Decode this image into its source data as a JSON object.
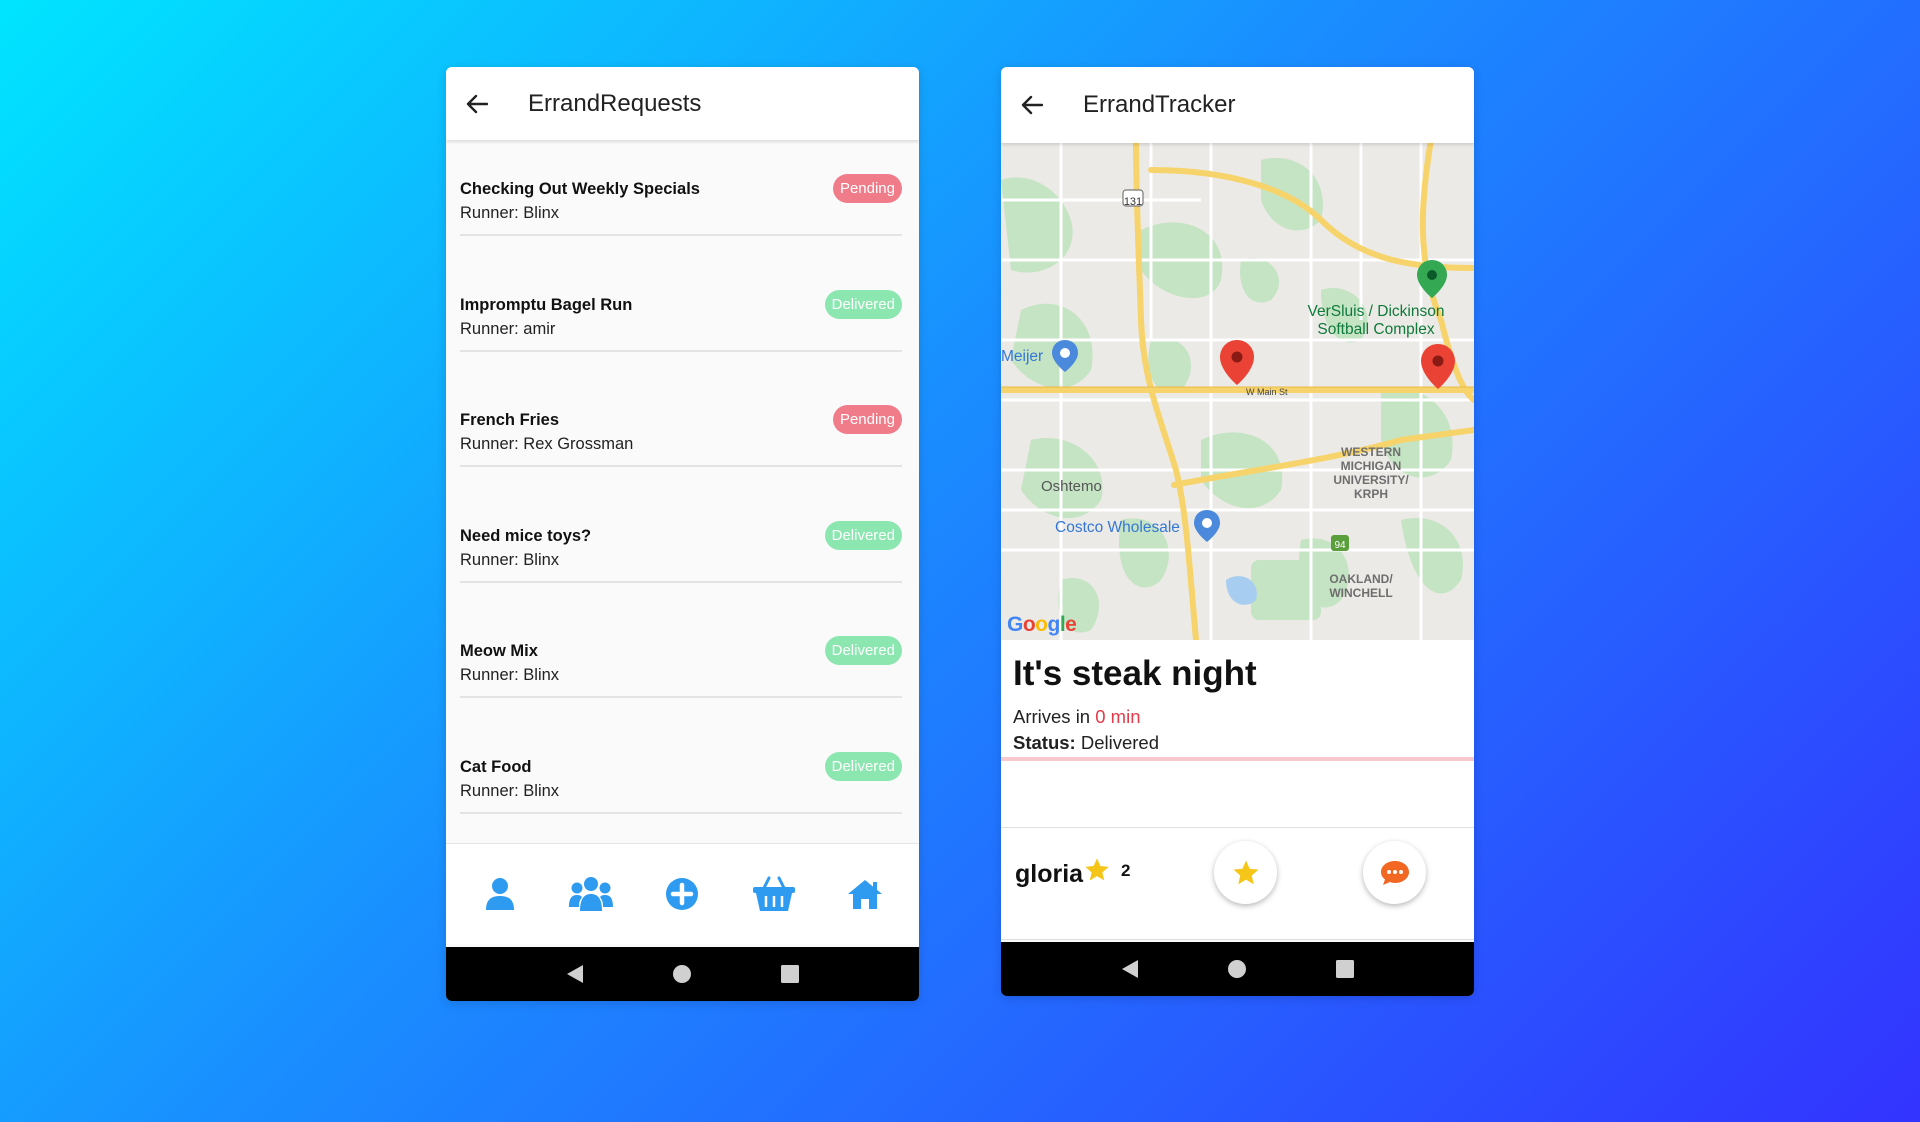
{
  "left": {
    "title": "ErrandRequests",
    "errands": [
      {
        "name": "Checking Out Weekly Specials",
        "runner": "Runner: Blinx",
        "status": "Pending"
      },
      {
        "name": "Impromptu Bagel Run",
        "runner": "Runner: amir",
        "status": "Delivered"
      },
      {
        "name": "French Fries",
        "runner": "Runner: Rex Grossman",
        "status": "Pending"
      },
      {
        "name": "Need mice toys?",
        "runner": "Runner: Blinx",
        "status": "Delivered"
      },
      {
        "name": "Meow Mix",
        "runner": "Runner: Blinx",
        "status": "Delivered"
      },
      {
        "name": "Cat Food",
        "runner": "Runner: Blinx",
        "status": "Delivered"
      }
    ],
    "nav": [
      "profile-icon",
      "group-icon",
      "add-circle-icon",
      "basket-icon",
      "home-icon"
    ]
  },
  "right": {
    "title": "ErrandTracker",
    "map": {
      "labels": {
        "versluis": "VerSluis / Dickinson\nSoftball Complex",
        "meijer": "Meijer",
        "oshtemo": "Oshtemo",
        "costco": "Costco Wholesale",
        "wmu": "WESTERN\nMICHIGAN\nUNIVERSITY/\nKRPH",
        "oakland": "OAKLAND/\nWINCHELL",
        "wmain": "W Main St",
        "hwy131": "131",
        "hwy94": "94",
        "google": "Google"
      }
    },
    "errand": {
      "name": "It's steak night",
      "arrives_prefix": "Arrives in ",
      "arrives_value": "0 min",
      "status_label": "Status:",
      "status_value": " Delivered"
    },
    "runner": {
      "name": "gloria",
      "rating": "2"
    }
  },
  "colors": {
    "pending": "#f07c8a",
    "delivered": "#8be6b0",
    "nav_blue": "#2f9bf0",
    "minutes_red": "#e23c4a"
  }
}
